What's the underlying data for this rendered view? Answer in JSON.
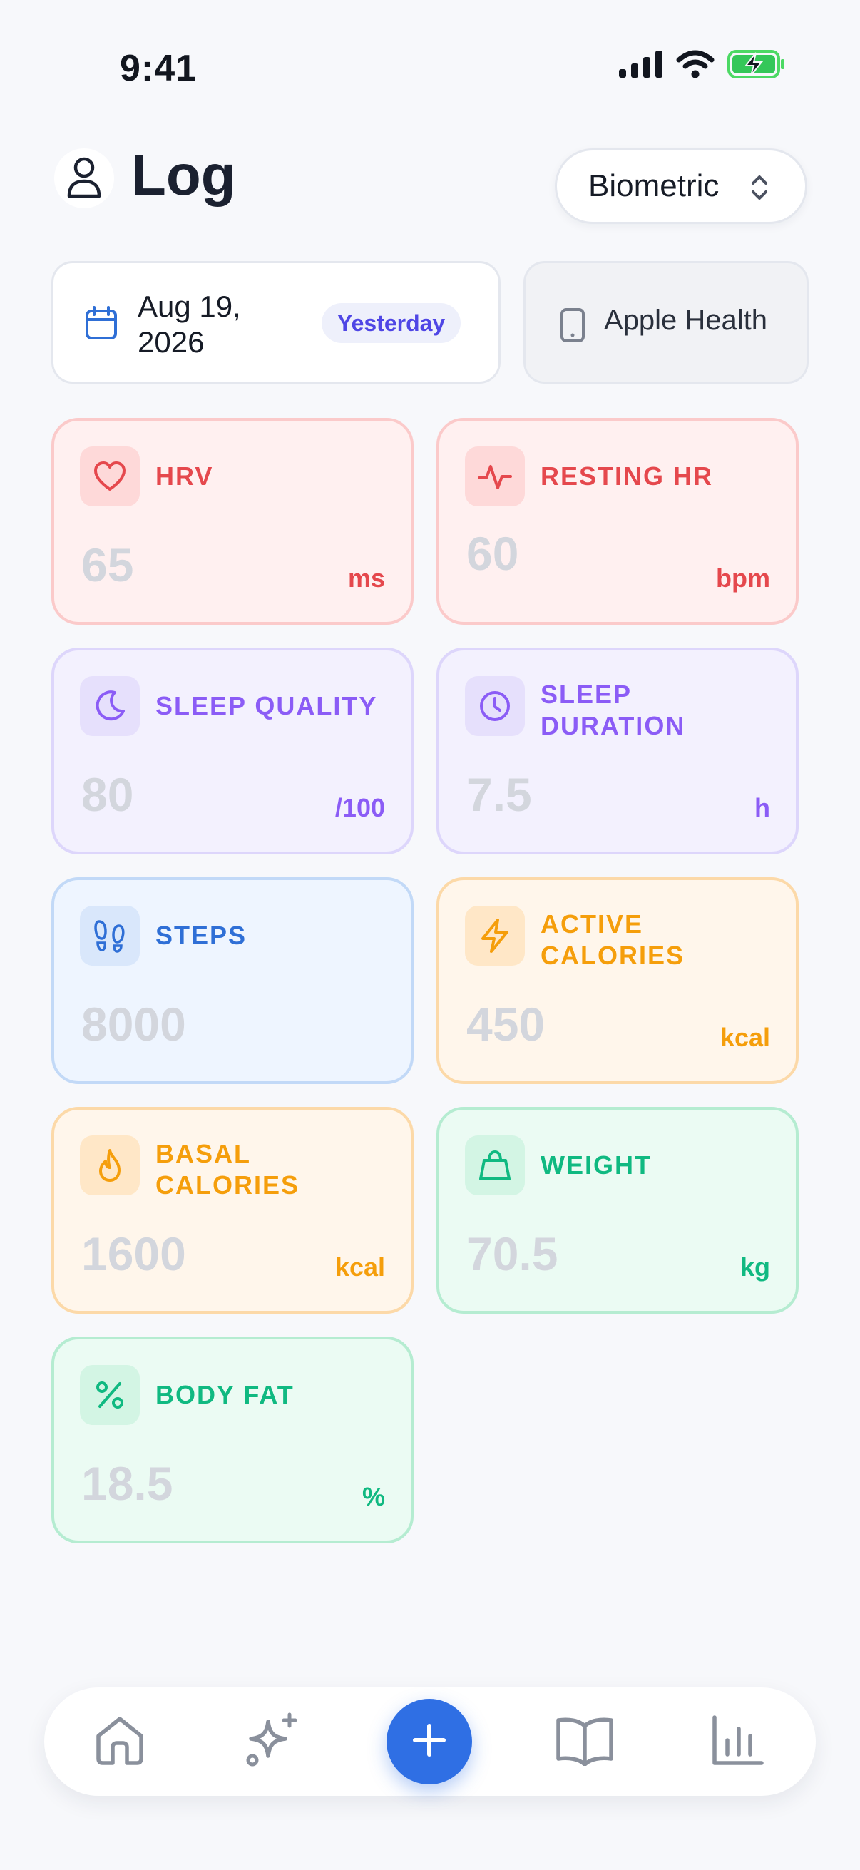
{
  "status_bar": {
    "time": "9:41"
  },
  "header": {
    "title": "Log",
    "mode_select": {
      "value": "Biometric"
    }
  },
  "date_selector": {
    "date": "Aug 19, 2026",
    "badge": "Yesterday"
  },
  "source": {
    "label": "Apple Health"
  },
  "metrics": [
    {
      "label": "HRV",
      "value": "65",
      "unit": "ms",
      "color": "#e5484d",
      "icon": "heart-icon"
    },
    {
      "label": "RESTING HR",
      "value": "60",
      "unit": "bpm",
      "color": "#e5484d",
      "icon": "pulse-icon"
    },
    {
      "label": "SLEEP QUALITY",
      "value": "80",
      "unit": "/100",
      "color": "#8b5cf6",
      "icon": "moon-icon"
    },
    {
      "label": "SLEEP DURATION",
      "value": "7.5",
      "unit": "h",
      "color": "#8b5cf6",
      "icon": "clock-icon"
    },
    {
      "label": "STEPS",
      "value": "8000",
      "unit": "",
      "color": "#2f6fd6",
      "icon": "footprints-icon"
    },
    {
      "label": "ACTIVE CALORIES",
      "value": "450",
      "unit": "kcal",
      "color": "#f59e0b",
      "icon": "bolt-icon"
    },
    {
      "label": "BASAL CALORIES",
      "value": "1600",
      "unit": "kcal",
      "color": "#f59e0b",
      "icon": "flame-icon"
    },
    {
      "label": "WEIGHT",
      "value": "70.5",
      "unit": "kg",
      "color": "#10b981",
      "icon": "weight-icon"
    },
    {
      "label": "BODY FAT",
      "value": "18.5",
      "unit": "%",
      "color": "#10b981",
      "icon": "percent-icon"
    }
  ],
  "bottom_nav": [
    "home-icon",
    "sparkles-icon",
    "plus-icon",
    "book-icon",
    "chart-icon"
  ],
  "colors": {
    "accent": "#2f6fe4",
    "background": "#f7f8fb"
  }
}
